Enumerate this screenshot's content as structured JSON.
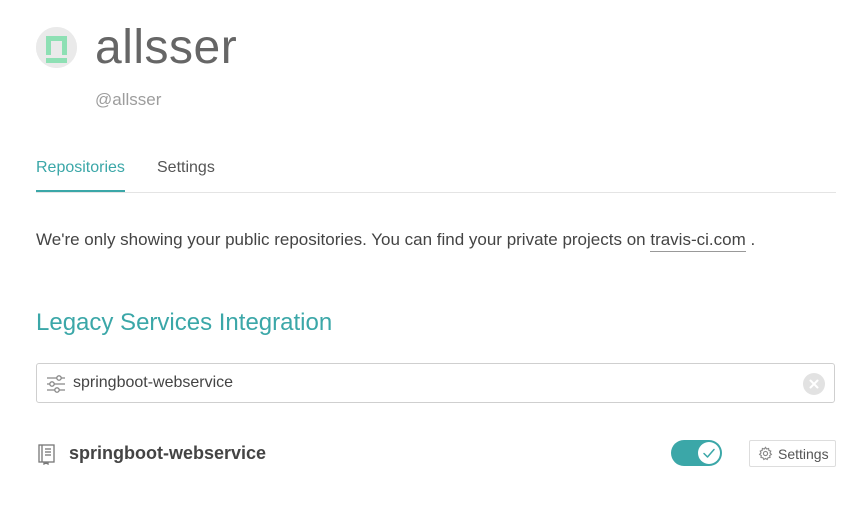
{
  "profile": {
    "name": "allsser",
    "handle": "@allsser",
    "avatar_icon": "identicon",
    "avatar_color": "#8ee0b4"
  },
  "tabs": [
    {
      "label": "Repositories",
      "active": true
    },
    {
      "label": "Settings",
      "active": false
    }
  ],
  "notice": {
    "text": "We're only showing your public repositories. You can find your private projects on",
    "link_text": "travis-ci.com",
    "suffix": "."
  },
  "section": {
    "title": "Legacy Services Integration"
  },
  "filter": {
    "value": "springboot-webservice",
    "filter_icon": "sliders-icon",
    "clear_icon": "close-icon"
  },
  "repositories": [
    {
      "name": "springboot-webservice",
      "icon": "repo-icon",
      "enabled": true,
      "settings_label": "Settings"
    }
  ],
  "colors": {
    "accent": "#3ba7a8",
    "text": "#444444",
    "muted": "#9d9d9d"
  }
}
